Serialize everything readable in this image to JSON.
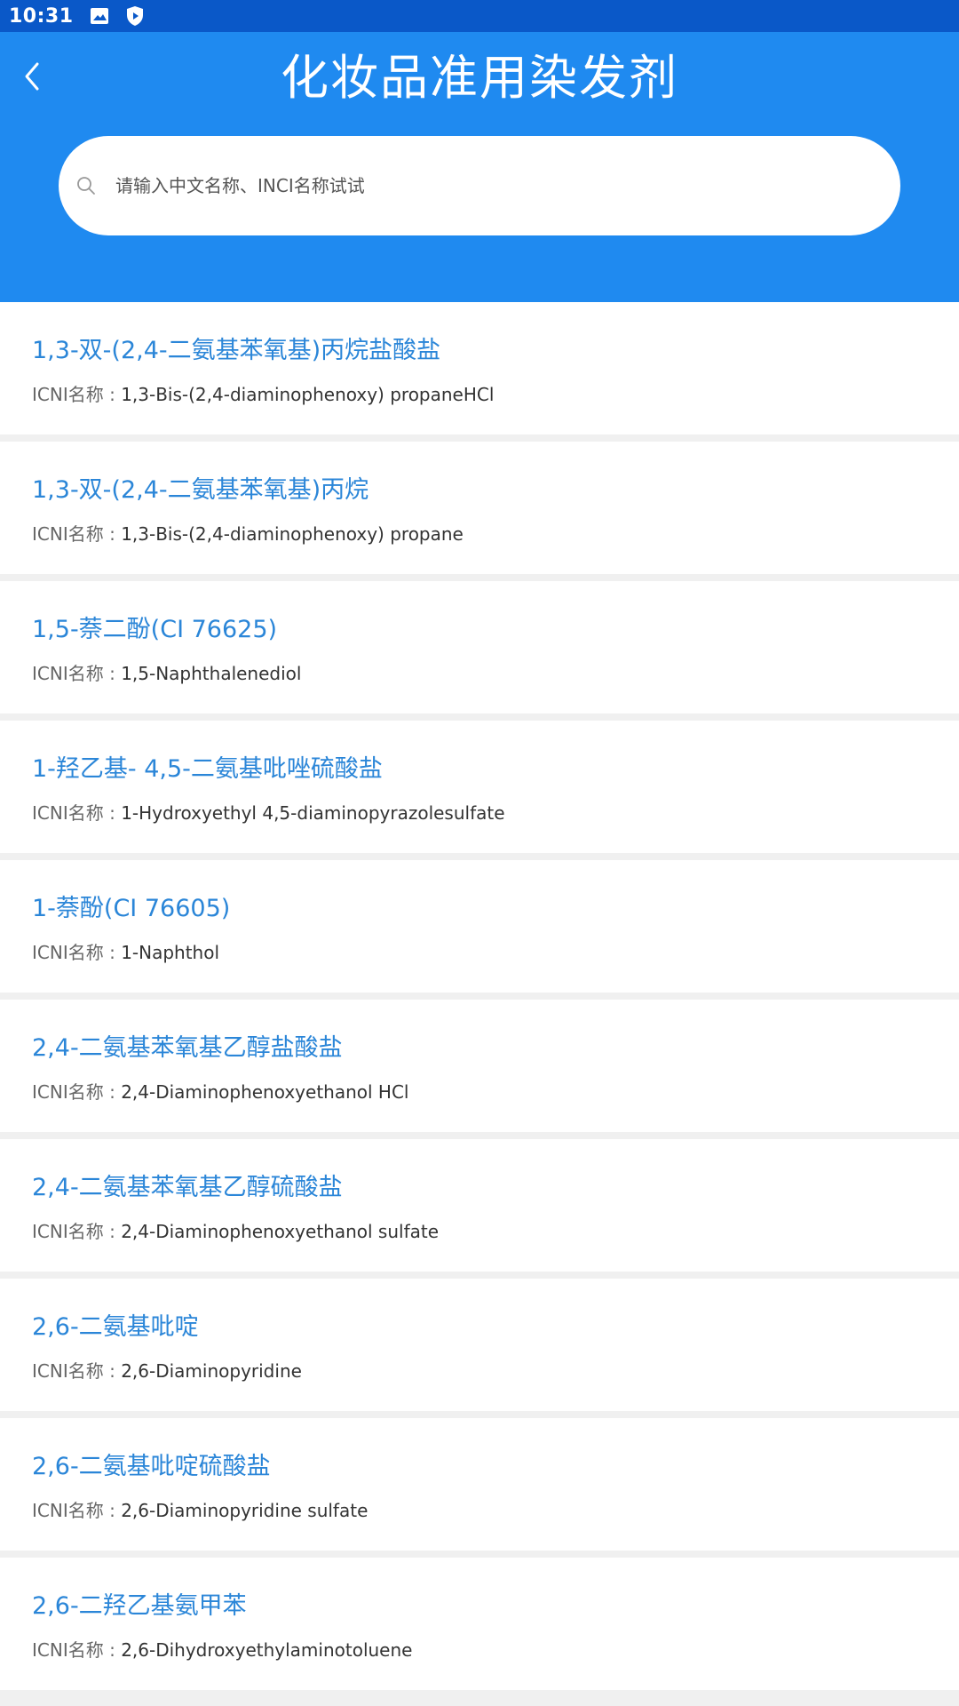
{
  "status_bar": {
    "time": "10:31",
    "icons": [
      "image-icon",
      "shield-play-icon"
    ]
  },
  "header": {
    "title": "化妆品准用染发剂",
    "back_icon": "chevron-left-icon"
  },
  "search": {
    "placeholder": "请输入中文名称、INCI名称试试",
    "value": "",
    "icon": "search-icon"
  },
  "list": {
    "items": [
      {
        "name": "1,3-双-(2,4-二氨基苯氧基)丙烷盐酸盐",
        "inci_label": "ICNI名称 : ",
        "inci": "1,3-Bis-(2,4-diaminophenoxy)   propaneHCl"
      },
      {
        "name": "1,3-双-(2,4-二氨基苯氧基)丙烷",
        "inci_label": "ICNI名称 : ",
        "inci": "1,3-Bis-(2,4-diaminophenoxy) propane"
      },
      {
        "name": "1,5-萘二酚(CI 76625)",
        "inci_label": "ICNI名称 : ",
        "inci": "1,5-Naphthalenediol"
      },
      {
        "name": "1-羟乙基-  4,5-二氨基吡唑硫酸盐",
        "inci_label": "ICNI名称 : ",
        "inci": "1-Hydroxyethyl 4,5-diaminopyrazolesulfate"
      },
      {
        "name": "1-萘酚(CI 76605)",
        "inci_label": "ICNI名称 : ",
        "inci": "1-Naphthol"
      },
      {
        "name": "2,4-二氨基苯氧基乙醇盐酸盐",
        "inci_label": "ICNI名称 : ",
        "inci": "2,4-Diaminophenoxyethanol HCl"
      },
      {
        "name": "2,4-二氨基苯氧基乙醇硫酸盐",
        "inci_label": "ICNI名称 : ",
        "inci": "2,4-Diaminophenoxyethanol sulfate"
      },
      {
        "name": "2,6-二氨基吡啶",
        "inci_label": "ICNI名称 : ",
        "inci": "2,6-Diaminopyridine"
      },
      {
        "name": "2,6-二氨基吡啶硫酸盐",
        "inci_label": "ICNI名称 : ",
        "inci": "2,6-Diaminopyridine sulfate"
      },
      {
        "name": "2,6-二羟乙基氨甲苯",
        "inci_label": "ICNI名称 : ",
        "inci": "2,6-Dihydroxyethylaminotoluene"
      }
    ]
  },
  "colors": {
    "status_bar": "#0a58c8",
    "header": "#1f8af0",
    "item_name": "#2b86d8",
    "divider": "#f0f0f0"
  }
}
